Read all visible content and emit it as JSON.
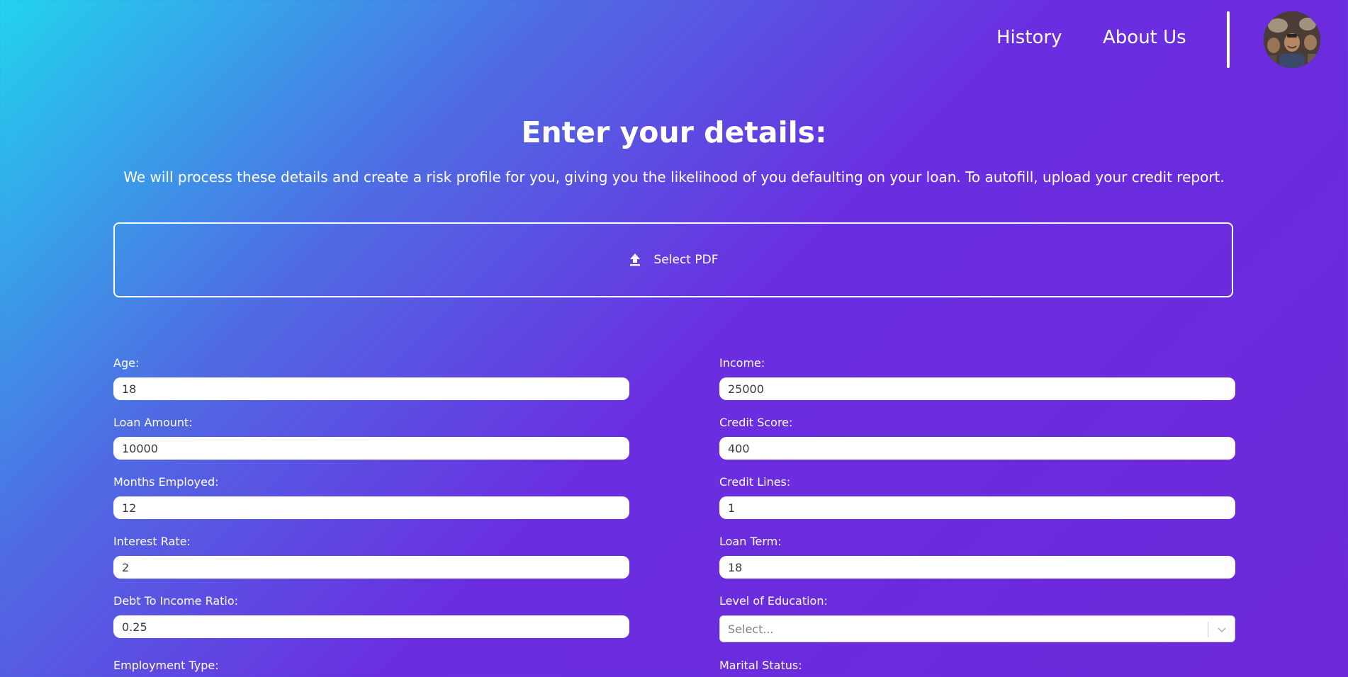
{
  "nav": {
    "history": "History",
    "about": "About Us"
  },
  "main": {
    "title": "Enter your details:",
    "subtitle": "We will process these details and create a risk profile for you, giving you the likelihood of you defaulting on your loan. To autofill, upload your credit report.",
    "upload_label": "Select PDF"
  },
  "fields": {
    "age": {
      "label": "Age:",
      "value": "18"
    },
    "income": {
      "label": "Income:",
      "value": "25000"
    },
    "loan_amount": {
      "label": "Loan Amount:",
      "value": "10000"
    },
    "credit_score": {
      "label": "Credit Score:",
      "value": "400"
    },
    "months_employed": {
      "label": "Months Employed:",
      "value": "12"
    },
    "credit_lines": {
      "label": "Credit Lines:",
      "value": "1"
    },
    "interest_rate": {
      "label": "Interest Rate:",
      "value": "2"
    },
    "loan_term": {
      "label": "Loan Term:",
      "value": "18"
    },
    "dti": {
      "label": "Debt To Income Ratio:",
      "value": "0.25"
    },
    "education": {
      "label": "Level of Education:",
      "placeholder": "Select..."
    },
    "employment_type": {
      "label": "Employment Type:"
    },
    "marital_status": {
      "label": "Marital Status:"
    }
  },
  "icons": {
    "upload": "upload-icon",
    "chevron": "chevron-down-icon",
    "avatar": "user-avatar"
  },
  "colors": {
    "gradient_start": "#22d3ee",
    "gradient_end": "#6d28d9",
    "text": "#ffffff"
  }
}
